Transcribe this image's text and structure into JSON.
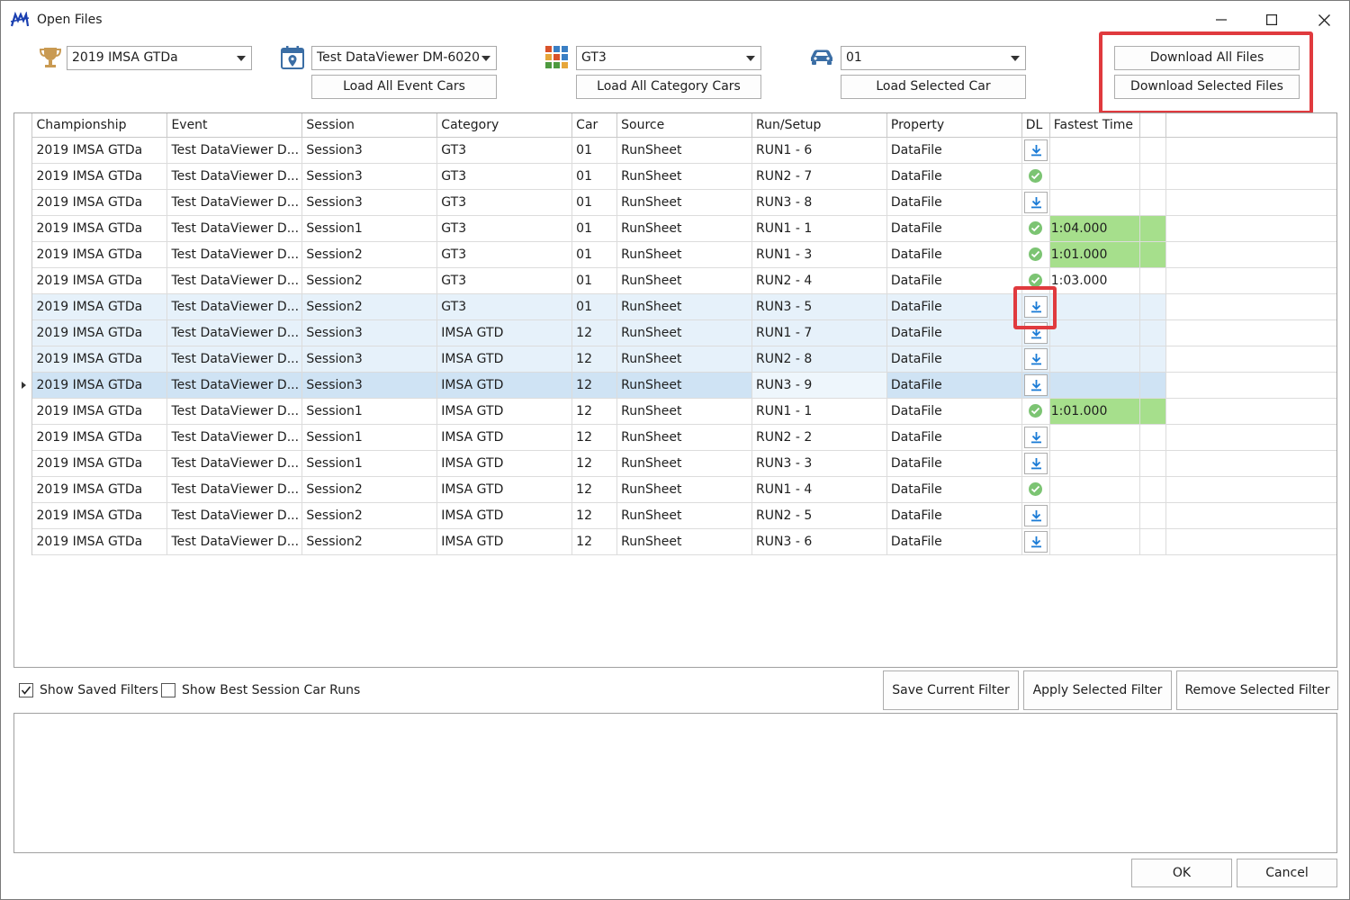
{
  "window": {
    "title": "Open Files"
  },
  "filters": {
    "championship": {
      "icon": "trophy-icon",
      "value": "2019 IMSA GTDa"
    },
    "event": {
      "icon": "calendar-location-icon",
      "value": "Test DataViewer DM-6020",
      "button": "Load All Event Cars"
    },
    "category": {
      "icon": "category-grid-icon",
      "value": "GT3",
      "button": "Load All Category Cars"
    },
    "car": {
      "icon": "car-icon",
      "value": "01",
      "button": "Load Selected Car"
    }
  },
  "downloads": {
    "all": "Download All Files",
    "selected": "Download Selected Files"
  },
  "grid": {
    "columns": [
      "Championship",
      "Event",
      "Session",
      "Category",
      "Car",
      "Source",
      "Run/Setup",
      "Property",
      "DL",
      "Fastest Time"
    ],
    "rows": [
      {
        "championship": "2019 IMSA GTDa",
        "event": "Test DataViewer D...",
        "session": "Session3",
        "category": "GT3",
        "car": "01",
        "source": "RunSheet",
        "run": "RUN1 - 6",
        "property": "DataFile",
        "dl": "download",
        "fastest": ""
      },
      {
        "championship": "2019 IMSA GTDa",
        "event": "Test DataViewer D...",
        "session": "Session3",
        "category": "GT3",
        "car": "01",
        "source": "RunSheet",
        "run": "RUN2 - 7",
        "property": "DataFile",
        "dl": "done",
        "fastest": ""
      },
      {
        "championship": "2019 IMSA GTDa",
        "event": "Test DataViewer D...",
        "session": "Session3",
        "category": "GT3",
        "car": "01",
        "source": "RunSheet",
        "run": "RUN3 - 8",
        "property": "DataFile",
        "dl": "download",
        "fastest": ""
      },
      {
        "championship": "2019 IMSA GTDa",
        "event": "Test DataViewer D...",
        "session": "Session1",
        "category": "GT3",
        "car": "01",
        "source": "RunSheet",
        "run": "RUN1 - 1",
        "property": "DataFile",
        "dl": "done",
        "fastest": "1:04.000",
        "best": true
      },
      {
        "championship": "2019 IMSA GTDa",
        "event": "Test DataViewer D...",
        "session": "Session2",
        "category": "GT3",
        "car": "01",
        "source": "RunSheet",
        "run": "RUN1 - 3",
        "property": "DataFile",
        "dl": "done",
        "fastest": "1:01.000",
        "best": true
      },
      {
        "championship": "2019 IMSA GTDa",
        "event": "Test DataViewer D...",
        "session": "Session2",
        "category": "GT3",
        "car": "01",
        "source": "RunSheet",
        "run": "RUN2 - 4",
        "property": "DataFile",
        "dl": "done",
        "fastest": "1:03.000"
      },
      {
        "championship": "2019 IMSA GTDa",
        "event": "Test DataViewer D...",
        "session": "Session2",
        "category": "GT3",
        "car": "01",
        "source": "RunSheet",
        "run": "RUN3 - 5",
        "property": "DataFile",
        "dl": "download",
        "fastest": "",
        "selected": true
      },
      {
        "championship": "2019 IMSA GTDa",
        "event": "Test DataViewer D...",
        "session": "Session3",
        "category": "IMSA GTD",
        "car": "12",
        "source": "RunSheet",
        "run": "RUN1 - 7",
        "property": "DataFile",
        "dl": "download",
        "fastest": "",
        "selected": true
      },
      {
        "championship": "2019 IMSA GTDa",
        "event": "Test DataViewer D...",
        "session": "Session3",
        "category": "IMSA GTD",
        "car": "12",
        "source": "RunSheet",
        "run": "RUN2 - 8",
        "property": "DataFile",
        "dl": "download",
        "fastest": "",
        "selected": true
      },
      {
        "championship": "2019 IMSA GTDa",
        "event": "Test DataViewer D...",
        "session": "Session3",
        "category": "IMSA GTD",
        "car": "12",
        "source": "RunSheet",
        "run": "RUN3 - 9",
        "property": "DataFile",
        "dl": "download",
        "fastest": "",
        "current": true
      },
      {
        "championship": "2019 IMSA GTDa",
        "event": "Test DataViewer D...",
        "session": "Session1",
        "category": "IMSA GTD",
        "car": "12",
        "source": "RunSheet",
        "run": "RUN1 - 1",
        "property": "DataFile",
        "dl": "done",
        "fastest": "1:01.000",
        "best": true
      },
      {
        "championship": "2019 IMSA GTDa",
        "event": "Test DataViewer D...",
        "session": "Session1",
        "category": "IMSA GTD",
        "car": "12",
        "source": "RunSheet",
        "run": "RUN2 - 2",
        "property": "DataFile",
        "dl": "download",
        "fastest": ""
      },
      {
        "championship": "2019 IMSA GTDa",
        "event": "Test DataViewer D...",
        "session": "Session1",
        "category": "IMSA GTD",
        "car": "12",
        "source": "RunSheet",
        "run": "RUN3 - 3",
        "property": "DataFile",
        "dl": "download",
        "fastest": ""
      },
      {
        "championship": "2019 IMSA GTDa",
        "event": "Test DataViewer D...",
        "session": "Session2",
        "category": "IMSA GTD",
        "car": "12",
        "source": "RunSheet",
        "run": "RUN1 - 4",
        "property": "DataFile",
        "dl": "done",
        "fastest": ""
      },
      {
        "championship": "2019 IMSA GTDa",
        "event": "Test DataViewer D...",
        "session": "Session2",
        "category": "IMSA GTD",
        "car": "12",
        "source": "RunSheet",
        "run": "RUN2 - 5",
        "property": "DataFile",
        "dl": "download",
        "fastest": ""
      },
      {
        "championship": "2019 IMSA GTDa",
        "event": "Test DataViewer D...",
        "session": "Session2",
        "category": "IMSA GTD",
        "car": "12",
        "source": "RunSheet",
        "run": "RUN3 - 6",
        "property": "DataFile",
        "dl": "download",
        "fastest": ""
      }
    ]
  },
  "options": {
    "show_saved_filters": {
      "label": "Show Saved Filters",
      "checked": true
    },
    "show_best_session": {
      "label": "Show Best Session Car Runs",
      "checked": false
    }
  },
  "filter_buttons": {
    "save": "Save Current Filter",
    "apply": "Apply Selected Filter",
    "remove": "Remove Selected Filter"
  },
  "footer": {
    "ok": "OK",
    "cancel": "Cancel"
  },
  "colors": {
    "highlight": "#e03a3e",
    "best_time": "#a6df8c",
    "download_blue": "#1a7bd6",
    "done_green": "#7cc473",
    "selected_row": "#e6f1fa",
    "current_row": "#cfe3f4"
  }
}
